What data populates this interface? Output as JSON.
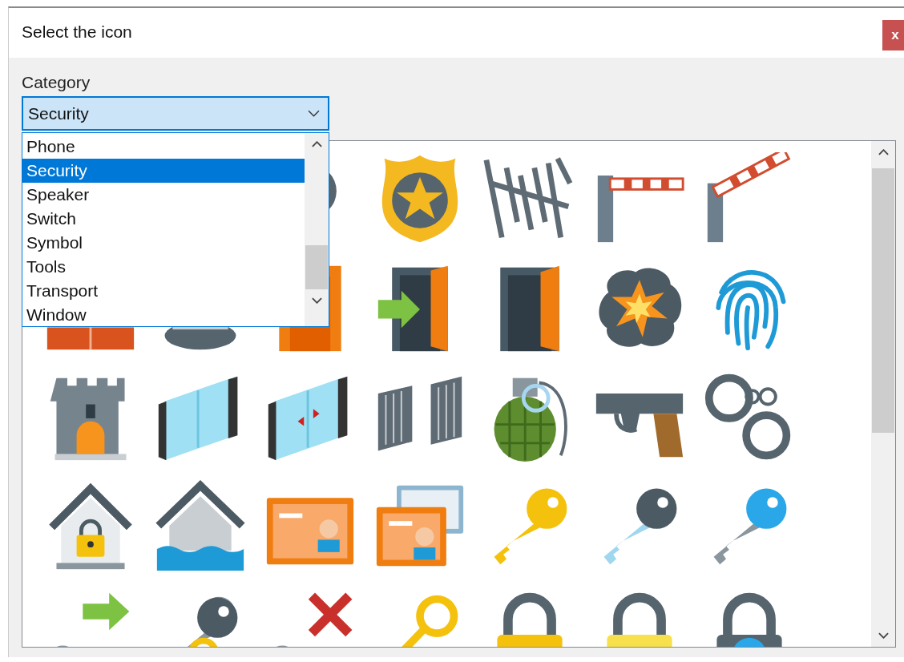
{
  "window": {
    "title": "Select the icon",
    "close": "x"
  },
  "category": {
    "label": "Category",
    "value": "Security",
    "expanded": true,
    "options": [
      {
        "label": "Phone",
        "selected": false
      },
      {
        "label": "Security",
        "selected": true
      },
      {
        "label": "Speaker",
        "selected": false
      },
      {
        "label": "Switch",
        "selected": false
      },
      {
        "label": "Symbol",
        "selected": false
      },
      {
        "label": "Tools",
        "selected": false
      },
      {
        "label": "Transport",
        "selected": false
      },
      {
        "label": "Window",
        "selected": false
      }
    ]
  }
}
